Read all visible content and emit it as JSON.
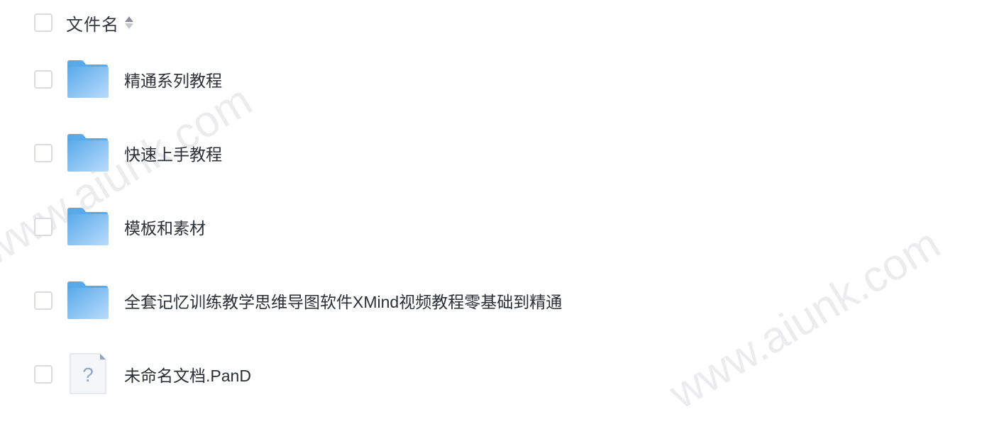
{
  "header": {
    "title": "文件名"
  },
  "files": [
    {
      "name": "精通系列教程",
      "type": "folder"
    },
    {
      "name": "快速上手教程",
      "type": "folder"
    },
    {
      "name": "模板和素材",
      "type": "folder"
    },
    {
      "name": "全套记忆训练教学思维导图软件XMind视频教程零基础到精通",
      "type": "folder"
    },
    {
      "name": "未命名文档.PanD",
      "type": "unknown-file"
    }
  ],
  "watermark": {
    "text": "www.aiunk.com"
  },
  "colors": {
    "folder_light": "#a9d6fb",
    "folder_dark": "#5aa9ea",
    "checkbox_border": "#d9dbe0",
    "text": "#2b2f36"
  }
}
